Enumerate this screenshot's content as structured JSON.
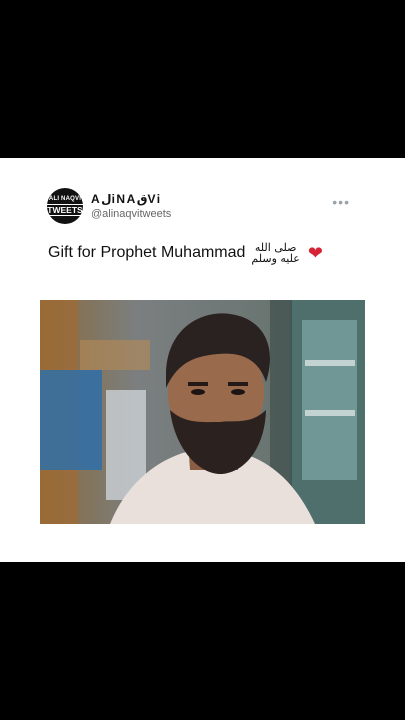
{
  "tweet": {
    "avatar_line1": "ALI NAQVI",
    "avatar_line2": "TWEETS",
    "display_name": "AلiNAقVi",
    "handle": "@alinaqvitweets",
    "more_label": "•••",
    "text": "Gift for Prophet Muhammad",
    "salawat_top": "صلى الله",
    "salawat_bottom": "عليه وسلم",
    "heart_emoji": "❤"
  },
  "colors": {
    "background": "#000000",
    "card": "#ffffff",
    "heart": "#d62336",
    "handle": "#666666"
  }
}
